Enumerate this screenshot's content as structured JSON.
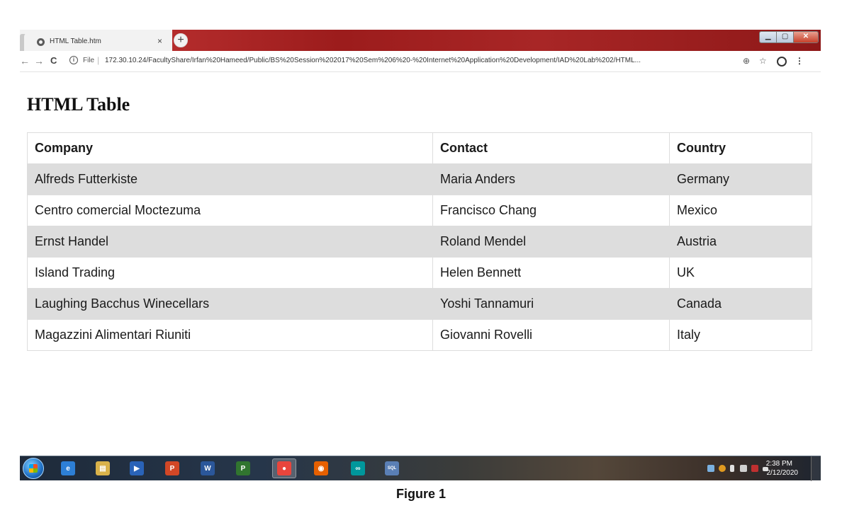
{
  "browser": {
    "tab_title": "HTML Table.htm",
    "tab_close": "×",
    "new_tab": "+",
    "url_scheme": "File",
    "url": "172.30.10.24/FacultyShare/Irfan%20Hameed/Public/BS%20Session%202017%20Sem%206%20-%20Internet%20Application%20Development/IAD%20Lab%202/HTML..."
  },
  "page": {
    "title": "HTML Table",
    "table": {
      "headers": [
        "Company",
        "Contact",
        "Country"
      ],
      "rows": [
        [
          "Alfreds Futterkiste",
          "Maria Anders",
          "Germany"
        ],
        [
          "Centro comercial Moctezuma",
          "Francisco Chang",
          "Mexico"
        ],
        [
          "Ernst Handel",
          "Roland Mendel",
          "Austria"
        ],
        [
          "Island Trading",
          "Helen Bennett",
          "UK"
        ],
        [
          "Laughing Bacchus Winecellars",
          "Yoshi Tannamuri",
          "Canada"
        ],
        [
          "Magazzini Alimentari Riuniti",
          "Giovanni Rovelli",
          "Italy"
        ]
      ]
    }
  },
  "taskbar": {
    "apps": [
      {
        "icon": "internet-explorer-icon",
        "glyph": "e",
        "color": "#2d7fd6"
      },
      {
        "icon": "file-explorer-icon",
        "glyph": "▤",
        "color": "#d9b24a"
      },
      {
        "icon": "media-player-icon",
        "glyph": "▶",
        "color": "#2a63b8"
      },
      {
        "icon": "powerpoint-icon",
        "glyph": "P",
        "color": "#d24726"
      },
      {
        "icon": "word-icon",
        "glyph": "W",
        "color": "#2b579a"
      },
      {
        "icon": "project-icon",
        "glyph": "P",
        "color": "#31752f"
      },
      {
        "icon": "chrome-icon",
        "glyph": "●",
        "color": "#e8453c"
      },
      {
        "icon": "firefox-icon",
        "glyph": "◉",
        "color": "#e66000"
      },
      {
        "icon": "arduino-icon",
        "glyph": "∞",
        "color": "#00979c"
      },
      {
        "icon": "sql-icon",
        "glyph": "SQL",
        "color": "#5a7fb5"
      }
    ],
    "clock_time": "2:38 PM",
    "clock_date": "2/12/2020"
  },
  "caption": "Figure 1"
}
